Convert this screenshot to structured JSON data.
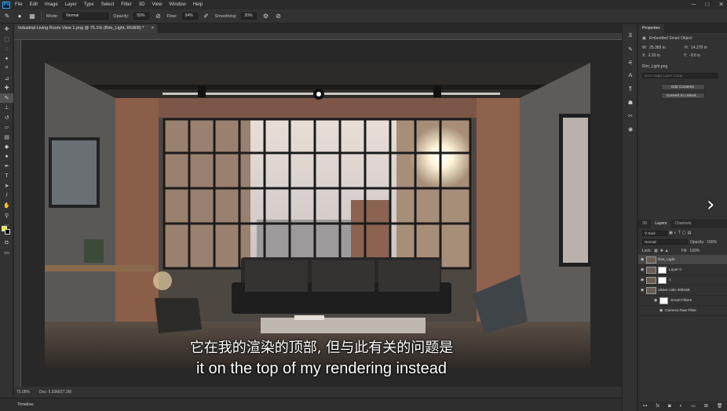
{
  "menubar": {
    "items": [
      "File",
      "Edit",
      "Image",
      "Layer",
      "Type",
      "Select",
      "Filter",
      "3D",
      "View",
      "Window",
      "Help"
    ]
  },
  "options": {
    "mode_label": "Mode:",
    "mode_value": "Normal",
    "opacity_label": "Opacity:",
    "opacity_value": "50%",
    "flow_label": "Flow:",
    "flow_value": "54%",
    "smoothing_label": "Smoothing:",
    "smoothing_value": "20%"
  },
  "document": {
    "tab_title": "Industrial Living Room View 1.png @ 75.1% (Rim_Light, RGB/8) *",
    "zoom": "75.08%",
    "doc_info": "Doc: 5.93M/27.3M"
  },
  "timeline": {
    "label": "Timeline"
  },
  "properties": {
    "tab": "Properties",
    "type": "Embedded Smart Object",
    "w_label": "W:",
    "w_value": "25.389 in",
    "h_label": "H:",
    "h_value": "14.278 in",
    "x_label": "X:",
    "x_value": "2.33 in",
    "y_label": "Y:",
    "y_value": "-9.6 in",
    "file_name": "Rim_Light.png",
    "comp_placeholder": "Don't Apply Layer Comp",
    "edit_contents": "Edit Contents",
    "convert_linked": "Convert to Linked..."
  },
  "layers_panel": {
    "tabs": [
      "3D",
      "Layers",
      "Channels"
    ],
    "active_tab": "Layers",
    "kind_filter": "Kind",
    "blend_mode": "Normal",
    "opacity_label": "Opacity:",
    "opacity_value": "100%",
    "lock_label": "Lock:",
    "fill_label": "Fill:",
    "fill_value": "100%",
    "layers": [
      {
        "name": "Rim_Light",
        "selected": true
      },
      {
        "name": "Layer 0",
        "selected": false
      },
      {
        "name": "1",
        "selected": false
      },
      {
        "name": "olivier-cole-409166",
        "selected": false
      }
    ],
    "smart_filters": "Smart Filters",
    "camera_raw": "Camera Raw Filter"
  },
  "subtitles": {
    "chinese": "它在我的渲染的顶部, 但与此有关的问题是",
    "english": "it on the top of my rendering instead"
  },
  "colors": {
    "foreground": "#e6f21a",
    "background": "#000000",
    "ps_blue": "#31a8ff"
  }
}
